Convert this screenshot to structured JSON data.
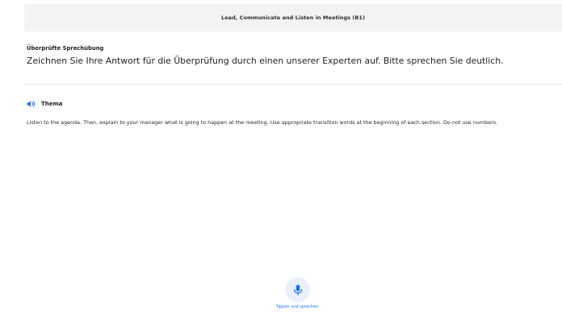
{
  "header": {
    "title": "Lead, Communicate and Listen in Meetings (B1)"
  },
  "exercise": {
    "type_label": "Überprüfte Sprechübung",
    "instruction": "Zeichnen Sie Ihre Antwort für die Überprüfung durch einen unserer Experten auf. Bitte sprechen Sie deutlich."
  },
  "topic": {
    "icon": "speaker-icon",
    "title": "Thema",
    "text": "Listen to the agenda. Then, explain to your manager what is going to happen at the meeting. Use appropriate transition words at the beginning of each section. Do not use numbers."
  },
  "recorder": {
    "icon": "microphone-icon",
    "label": "Tippen und sprechen"
  },
  "colors": {
    "accent": "#1a73e8",
    "mic_background": "#e9f0fb",
    "header_background": "#f2f3f5"
  }
}
